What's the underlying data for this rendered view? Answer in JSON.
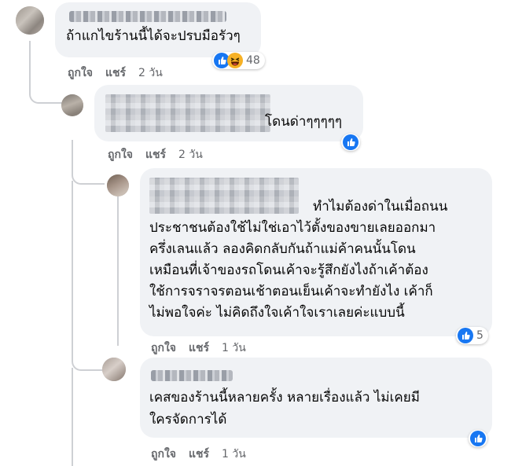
{
  "comments": [
    {
      "text": "ถ้าแกไขร้านนี้ได้จะปรบมือรัวๆ",
      "reactions": {
        "icons": [
          "like-icon",
          "haha-icon"
        ],
        "count": "48"
      },
      "actions": {
        "like": "ถูกใจ",
        "share": "แชร์",
        "time": "2 วัน"
      }
    },
    {
      "text": "โดนด่าๆๆๆๆๆ",
      "reactions": {
        "icons": [
          "like-icon"
        ],
        "count": ""
      },
      "actions": {
        "like": "ถูกใจ",
        "share": "แชร์",
        "time": "2 วัน"
      }
    },
    {
      "text_lines": [
        "ทำไมต้องด่าในเมื่อถนน",
        "ประชาชนต้องใช้ไม่ใช่เอาไว้ตั้งของขายเลยออกมา",
        "ครึ่งเลนแล้ว ลองคิดกลับกันถ้าแม่ค้าคนนั้นโดน",
        "เหมือนที่เจ้าของรถโดนเค้าจะรู้สึกยังไงถ้าเค้าต้อง",
        "ใช้การจราจรตอนเช้าตอนเย็นเค้าจะทำยังไง เค้าก็",
        "ไม่พอใจค่ะ ไม่คิดถึงใจเค้าใจเราเลยค่ะแบบนี้"
      ],
      "reactions": {
        "icons": [
          "like-icon"
        ],
        "count": "5"
      },
      "actions": {
        "like": "ถูกใจ",
        "share": "แชร์",
        "time": "1 วัน"
      }
    },
    {
      "text_lines": [
        "เคสของร้านนี้หลายครั้ง หลายเรื่องแล้ว ไม่เคยมี",
        "ใครจัดการได้"
      ],
      "reactions": {
        "icons": [
          "like-icon"
        ],
        "count": ""
      },
      "actions": {
        "like": "ถูกใจ",
        "share": "แชร์",
        "time": "1 วัน"
      }
    }
  ],
  "colors": {
    "like_blue": "#1877f2",
    "haha_yellow": "#f7b125",
    "bubble": "#f0f2f5",
    "meta_gray": "#65676b"
  }
}
